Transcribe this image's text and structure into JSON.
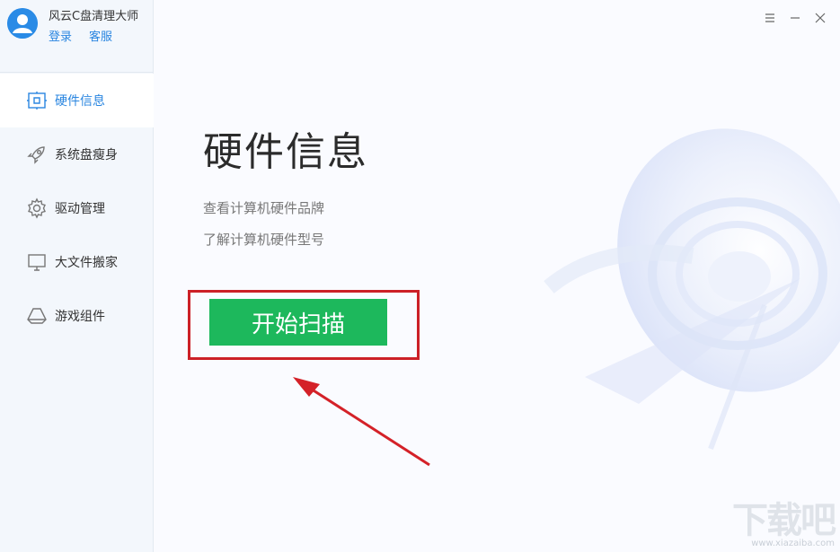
{
  "app": {
    "name": "风云C盘清理大师",
    "login": "登录",
    "service": "客服"
  },
  "sidebar": {
    "items": [
      {
        "label": "硬件信息",
        "icon": "hardware-icon",
        "active": true
      },
      {
        "label": "系统盘瘦身",
        "icon": "rocket-icon",
        "active": false
      },
      {
        "label": "驱动管理",
        "icon": "gear-icon",
        "active": false
      },
      {
        "label": "大文件搬家",
        "icon": "monitor-icon",
        "active": false
      },
      {
        "label": "游戏组件",
        "icon": "game-drive-icon",
        "active": false
      }
    ]
  },
  "main": {
    "title": "硬件信息",
    "desc1": "查看计算机硬件品牌",
    "desc2": "了解计算机硬件型号",
    "scan_button": "开始扫描"
  },
  "watermark": {
    "main": "下载吧",
    "sub": "www.xiazaiba.com"
  },
  "colors": {
    "accent": "#2a86e0",
    "button": "#1db85c",
    "highlight": "#cc2027"
  }
}
